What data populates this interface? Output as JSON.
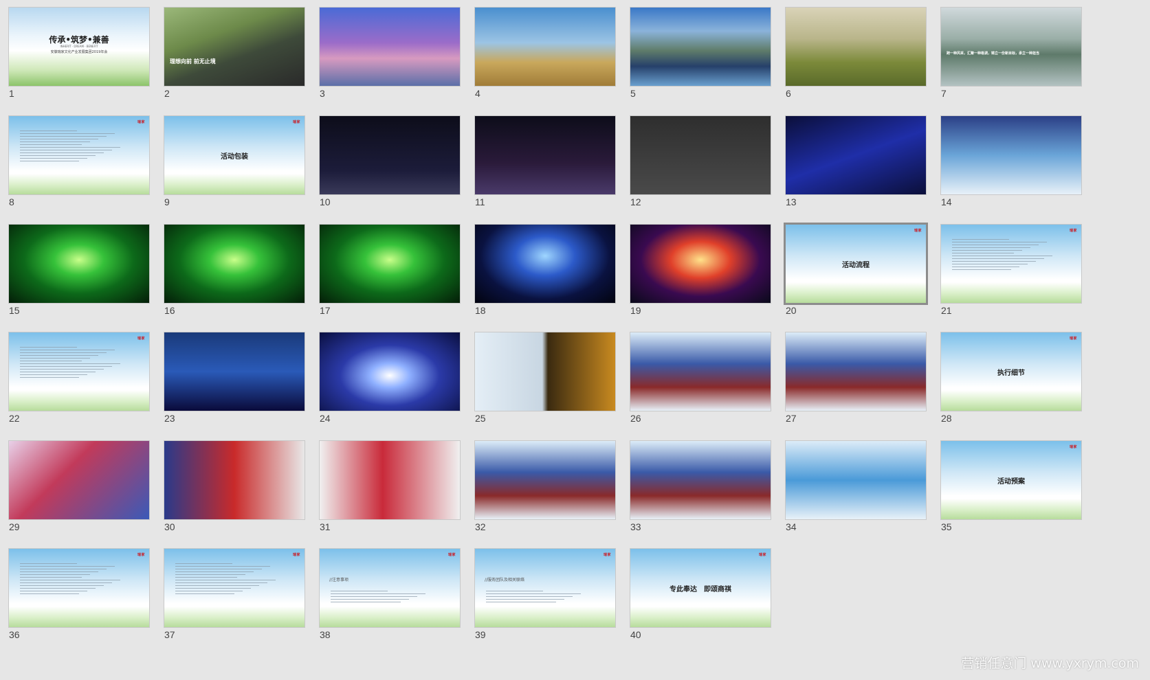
{
  "watermark": "营销任意门 www.yxrym.com",
  "slides": [
    {
      "n": "1",
      "kind": "cover",
      "title": "传承•筑梦•兼善",
      "subtitle": "INHERIT · DREAM · BENEFIT",
      "line": "安徽瑞家文化产业发展集团2019年会"
    },
    {
      "n": "2",
      "kind": "photo",
      "caption": "理想向前 前无止境",
      "bg": "road"
    },
    {
      "n": "3",
      "kind": "photo",
      "caption": "",
      "bg": "jump"
    },
    {
      "n": "4",
      "kind": "photo",
      "caption": "",
      "bg": "field"
    },
    {
      "n": "5",
      "kind": "photo",
      "caption": "",
      "bg": "lake"
    },
    {
      "n": "6",
      "kind": "photo",
      "caption": "",
      "bg": "tree"
    },
    {
      "n": "7",
      "kind": "photo",
      "caption": "跨一种风采，汇聚一种格调，铸立一份新目标，承立一种担当",
      "bg": "mist"
    },
    {
      "n": "8",
      "kind": "text",
      "title": "",
      "bg": "sky"
    },
    {
      "n": "9",
      "kind": "title",
      "title": "活动包装",
      "bg": "sky"
    },
    {
      "n": "10",
      "kind": "photo",
      "caption": "",
      "bg": "booth"
    },
    {
      "n": "11",
      "kind": "photo",
      "caption": "",
      "bg": "booth2"
    },
    {
      "n": "12",
      "kind": "photo",
      "caption": "",
      "bg": "gray"
    },
    {
      "n": "13",
      "kind": "photo",
      "caption": "",
      "bg": "blue"
    },
    {
      "n": "14",
      "kind": "photo",
      "caption": "",
      "bg": "crowd"
    },
    {
      "n": "15",
      "kind": "photo",
      "caption": "",
      "bg": "green"
    },
    {
      "n": "16",
      "kind": "photo",
      "caption": "",
      "bg": "green"
    },
    {
      "n": "17",
      "kind": "photo",
      "caption": "",
      "bg": "green"
    },
    {
      "n": "18",
      "kind": "photo",
      "caption": "",
      "bg": "stageblue"
    },
    {
      "n": "19",
      "kind": "photo",
      "caption": "",
      "bg": "concert"
    },
    {
      "n": "20",
      "kind": "title",
      "title": "活动流程",
      "bg": "sky",
      "selected": true
    },
    {
      "n": "21",
      "kind": "text",
      "title": "",
      "bg": "sky"
    },
    {
      "n": "22",
      "kind": "text",
      "title": "",
      "bg": "sky"
    },
    {
      "n": "23",
      "kind": "photo",
      "caption": "",
      "bg": "show"
    },
    {
      "n": "24",
      "kind": "photo",
      "caption": "",
      "bg": "violin"
    },
    {
      "n": "25",
      "kind": "photo",
      "caption": "",
      "bg": "dance"
    },
    {
      "n": "26",
      "kind": "photo",
      "caption": "",
      "bg": "people"
    },
    {
      "n": "27",
      "kind": "photo",
      "caption": "",
      "bg": "people"
    },
    {
      "n": "28",
      "kind": "title",
      "title": "执行细节",
      "bg": "sky"
    },
    {
      "n": "29",
      "kind": "photo",
      "caption": "",
      "bg": "invite"
    },
    {
      "n": "30",
      "kind": "photo",
      "caption": "",
      "bg": "flowers"
    },
    {
      "n": "31",
      "kind": "photo",
      "caption": "",
      "bg": "speech"
    },
    {
      "n": "32",
      "kind": "photo",
      "caption": "",
      "bg": "people"
    },
    {
      "n": "33",
      "kind": "photo",
      "caption": "",
      "bg": "people"
    },
    {
      "n": "34",
      "kind": "photo",
      "caption": "",
      "bg": "gifts"
    },
    {
      "n": "35",
      "kind": "title",
      "title": "活动预案",
      "bg": "sky"
    },
    {
      "n": "36",
      "kind": "text",
      "title": "",
      "bg": "sky"
    },
    {
      "n": "37",
      "kind": "text",
      "title": "",
      "bg": "sky"
    },
    {
      "n": "38",
      "kind": "text",
      "title": "//注意事项",
      "bg": "sky"
    },
    {
      "n": "39",
      "kind": "text",
      "title": "//服务团队及相关联络",
      "bg": "sky"
    },
    {
      "n": "40",
      "kind": "title",
      "title": "专此奉达　即颂商祺",
      "bg": "sky"
    }
  ],
  "logo_text": "瑞家",
  "colors": {
    "sky_top": "#6fb6e6",
    "sky_bottom": "#ffffff",
    "dark": "#1a1a2e",
    "green": "#1f8a2e",
    "blue": "#1a2a9a"
  }
}
